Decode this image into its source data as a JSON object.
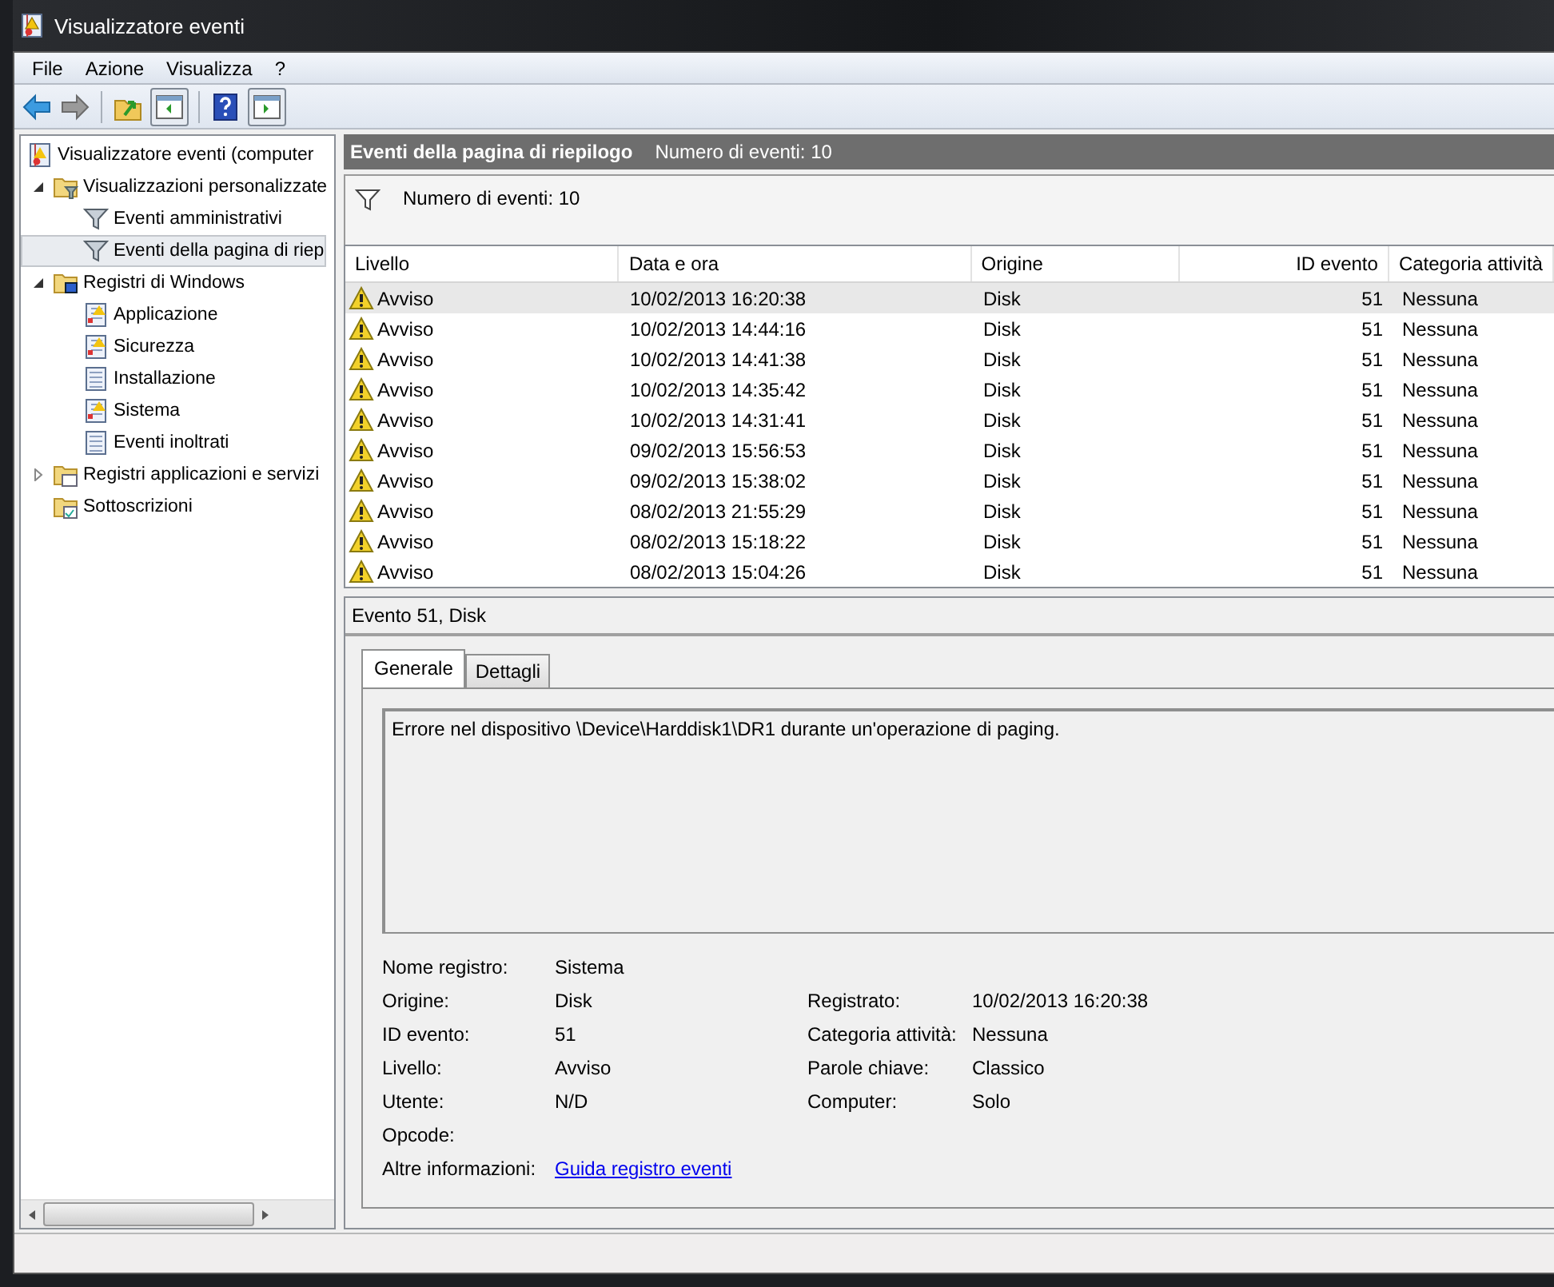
{
  "window": {
    "title": "Visualizzatore eventi"
  },
  "menu": [
    "File",
    "Azione",
    "Visualizza",
    "?"
  ],
  "tree": {
    "root": {
      "label": "Visualizzatore eventi (computer",
      "selected": false
    },
    "items": [
      {
        "label": "Visualizzazioni personalizzate",
        "kind": "filter-folder",
        "selected": false,
        "expanded": true,
        "children": [
          {
            "label": "Eventi amministrativi",
            "kind": "filter",
            "selected": false
          },
          {
            "label": "Eventi della pagina di riep",
            "kind": "filter",
            "selected": true
          }
        ]
      },
      {
        "label": "Registri di Windows",
        "kind": "windows-folder",
        "selected": false,
        "expanded": true,
        "children": [
          {
            "label": "Applicazione",
            "kind": "log-warn",
            "selected": false
          },
          {
            "label": "Sicurezza",
            "kind": "log-warn",
            "selected": false
          },
          {
            "label": "Installazione",
            "kind": "log",
            "selected": false
          },
          {
            "label": "Sistema",
            "kind": "log-warn",
            "selected": false
          },
          {
            "label": "Eventi inoltrati",
            "kind": "log",
            "selected": false
          }
        ]
      },
      {
        "label": "Registri applicazioni e servizi",
        "kind": "folder",
        "selected": false,
        "expanded": false
      },
      {
        "label": "Sottoscrizioni",
        "kind": "subscriptions",
        "selected": false
      }
    ]
  },
  "header": {
    "title": "Eventi della pagina di riepilogo",
    "count": "Numero di eventi: 10"
  },
  "filter": {
    "text": "Numero di eventi: 10"
  },
  "table": {
    "columns": [
      "Livello",
      "Data e ora",
      "Origine",
      "ID evento",
      "Categoria attività"
    ],
    "rows": [
      {
        "cells": [
          "Avviso",
          "10/02/2013 16:20:38",
          "Disk",
          "51",
          "Nessuna"
        ],
        "selected": true
      },
      {
        "cells": [
          "Avviso",
          "10/02/2013 14:44:16",
          "Disk",
          "51",
          "Nessuna"
        ],
        "selected": false
      },
      {
        "cells": [
          "Avviso",
          "10/02/2013 14:41:38",
          "Disk",
          "51",
          "Nessuna"
        ],
        "selected": false
      },
      {
        "cells": [
          "Avviso",
          "10/02/2013 14:35:42",
          "Disk",
          "51",
          "Nessuna"
        ],
        "selected": false
      },
      {
        "cells": [
          "Avviso",
          "10/02/2013 14:31:41",
          "Disk",
          "51",
          "Nessuna"
        ],
        "selected": false
      },
      {
        "cells": [
          "Avviso",
          "09/02/2013 15:56:53",
          "Disk",
          "51",
          "Nessuna"
        ],
        "selected": false
      },
      {
        "cells": [
          "Avviso",
          "09/02/2013 15:38:02",
          "Disk",
          "51",
          "Nessuna"
        ],
        "selected": false
      },
      {
        "cells": [
          "Avviso",
          "08/02/2013 21:55:29",
          "Disk",
          "51",
          "Nessuna"
        ],
        "selected": false
      },
      {
        "cells": [
          "Avviso",
          "08/02/2013 15:18:22",
          "Disk",
          "51",
          "Nessuna"
        ],
        "selected": false
      },
      {
        "cells": [
          "Avviso",
          "08/02/2013 15:04:26",
          "Disk",
          "51",
          "Nessuna"
        ],
        "selected": false
      }
    ]
  },
  "event": {
    "title": "Evento 51, Disk",
    "tabs": [
      {
        "label": "Generale",
        "selected": true
      },
      {
        "label": "Dettagli",
        "selected": false
      }
    ],
    "description": "Errore nel dispositivo \\Device\\Harddisk1\\DR1 durante un'operazione di paging.",
    "left": [
      {
        "label": "Nome registro:",
        "value": "Sistema"
      },
      {
        "label": "Origine:",
        "value": "Disk"
      },
      {
        "label": "ID evento:",
        "value": "51"
      },
      {
        "label": "Livello:",
        "value": "Avviso"
      },
      {
        "label": "Utente:",
        "value": "N/D"
      },
      {
        "label": "Opcode:"
      },
      {
        "label": "Altre informazioni:",
        "link": "Guida registro eventi"
      }
    ],
    "right": [
      {
        "label": "Registrato:",
        "value": "10/02/2013 16:20:38"
      },
      {
        "label": "Categoria attività:",
        "value": "Nessuna"
      },
      {
        "label": "Parole chiave:",
        "value": "Classico"
      },
      {
        "label": "Computer:",
        "value": "Solo"
      }
    ]
  }
}
